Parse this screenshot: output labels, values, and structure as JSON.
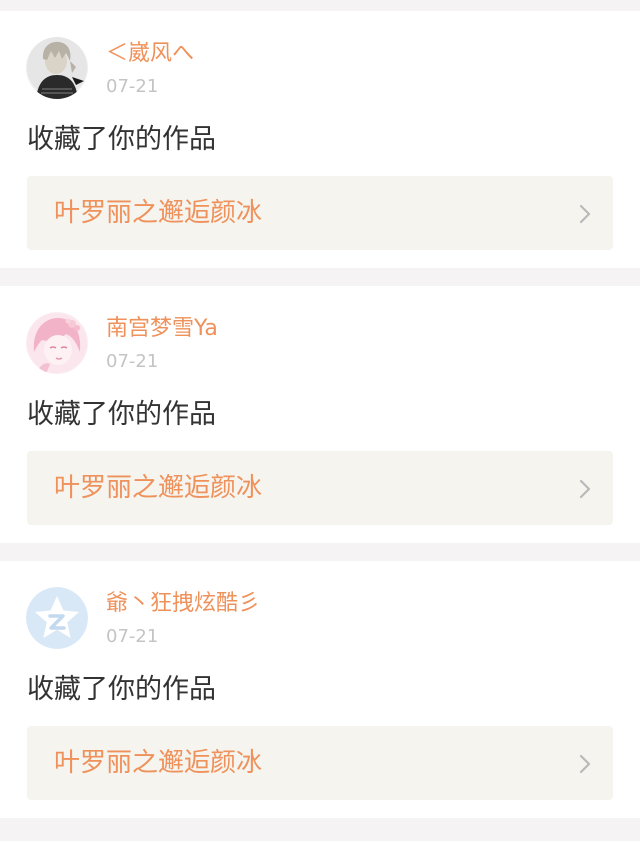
{
  "notifications": [
    {
      "username": "＜崴风へ",
      "timestamp": "07-21",
      "action": "收藏了你的作品",
      "work_title": "叶罗丽之邂逅颜冰",
      "avatar_icon": "anime-boy-avatar-icon"
    },
    {
      "username": "南宫梦雪Ya",
      "timestamp": "07-21",
      "action": "收藏了你的作品",
      "work_title": "叶罗丽之邂逅颜冰",
      "avatar_icon": "pink-anime-girl-avatar-icon"
    },
    {
      "username": "爺丶狂拽炫酷彡",
      "timestamp": "07-21",
      "action": "收藏了你的作品",
      "work_title": "叶罗丽之邂逅颜冰",
      "avatar_icon": "default-star-avatar-icon"
    }
  ],
  "colors": {
    "accent": "#ef915a",
    "timestamp": "#c4c4c4",
    "body_text": "#333333",
    "link_background": "#f5f4ef",
    "page_background": "#f5f3f4"
  }
}
